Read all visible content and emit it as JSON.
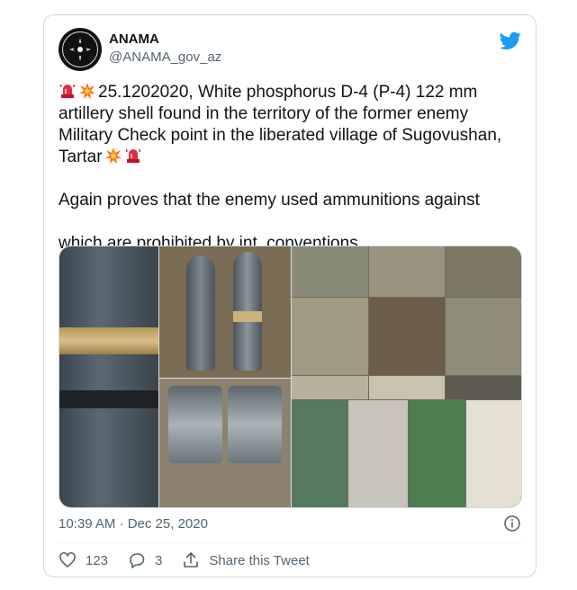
{
  "tweet": {
    "author_name": "ANAMA",
    "author_handle": "@ANAMA_gov_az",
    "paragraph1": "25.1202020, White phosphorus D-4 (P-4) 122 mm artillery shell found in the territory of the former enemy Military Check point in the liberated village of Sugovushan, Tartar",
    "paragraph2": "which are prohibited by int. conventions.",
    "paragraph2_prefix": "Again proves that the enemy used ammunitions against",
    "timestamp": "10:39 AM · Dec 25, 2020",
    "likes": "123",
    "replies": "3",
    "share_label": "Share this Tweet"
  },
  "icons": [
    "twitter-bird-icon",
    "siren-icon",
    "explosion-icon",
    "azerbaijan-flag-icon",
    "info-icon",
    "heart-icon",
    "reply-icon",
    "share-icon"
  ],
  "colors": {
    "accent": "#1d9bf0",
    "secondary_text": "#536471",
    "border": "#cfd9de"
  }
}
